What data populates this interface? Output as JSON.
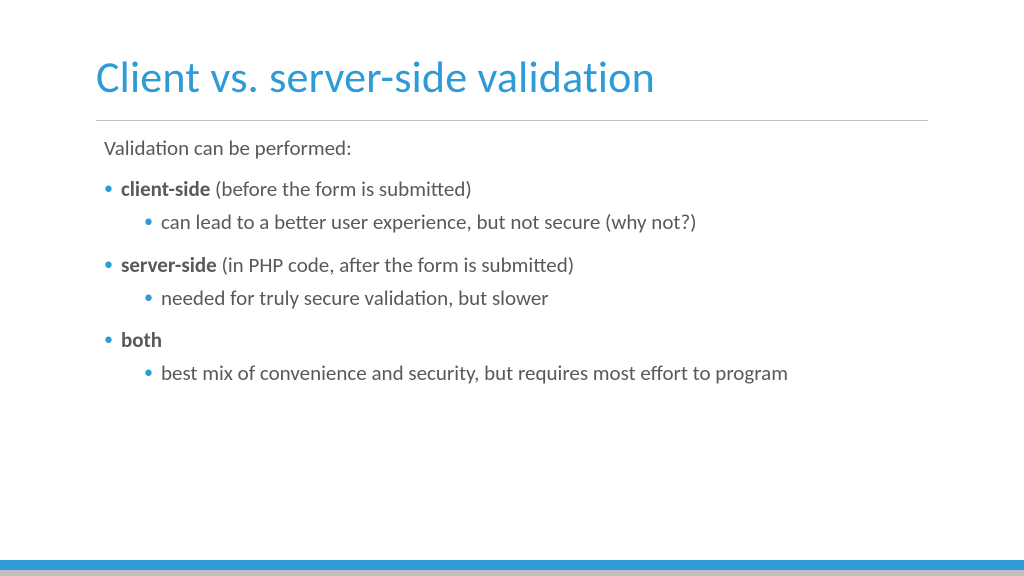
{
  "title": "Client vs. server-side validation",
  "intro": "Validation can be performed:",
  "items": [
    {
      "term": "client-side",
      "rest": " (before the form is submitted)",
      "sub": "can lead to a better user experience, but not secure (why not?)"
    },
    {
      "term": "server-side",
      "rest": " (in PHP code, after the form is submitted)",
      "sub": "needed for truly secure validation, but slower"
    },
    {
      "term": "both",
      "rest": "",
      "sub": "best mix of convenience and security, but requires most effort to program"
    }
  ]
}
